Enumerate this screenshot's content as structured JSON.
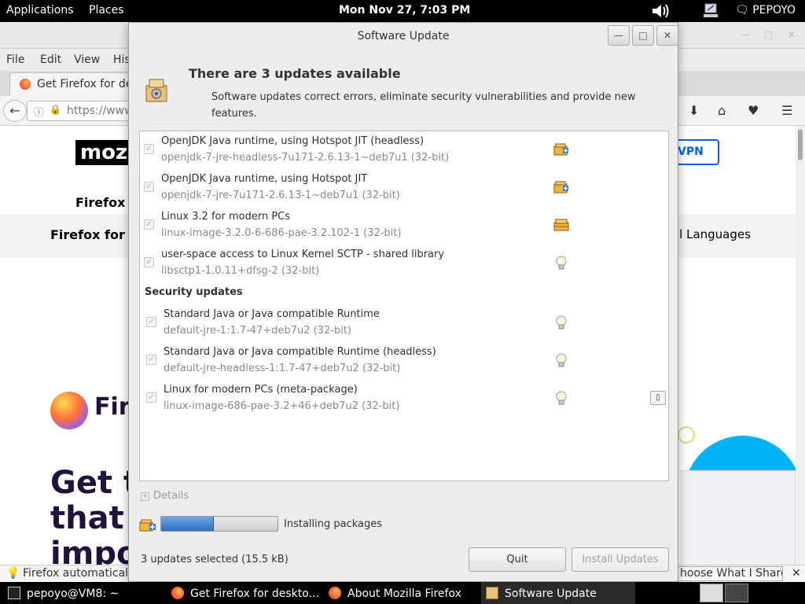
{
  "top_panel": {
    "applications": "Applications",
    "places": "Places",
    "clock": "Mon Nov 27,  7:03 PM",
    "user": "PEPOYO"
  },
  "firefox": {
    "menu": [
      "File",
      "Edit",
      "View",
      "His"
    ],
    "tab_title": "Get Firefox for de",
    "url": "https://www",
    "page": {
      "logo": "moz",
      "vpn": "VPN",
      "subnav": "Firefox B",
      "band_left": "Firefox for D",
      "band_right": "ll Languages",
      "brand": "Fire",
      "headline": [
        "Get t",
        "that p",
        "impo"
      ]
    },
    "status_left": "Firefox automatically",
    "status_right": "hoose What I Share"
  },
  "dialog": {
    "title": "Software Update",
    "heading": "There are 3 updates available",
    "subheading": "Software updates correct errors, eliminate security vulnerabilities and provide new features.",
    "updates": [
      {
        "name": "OpenJDK Java runtime, using Hotspot JIT (headless)",
        "package": "openjdk-7-jre-headless-7u171-2.6.13-1~deb7u1 (32-bit)",
        "icon": "package-add-icon"
      },
      {
        "name": "OpenJDK Java runtime, using Hotspot JIT",
        "package": "openjdk-7-jre-7u171-2.6.13-1~deb7u1 (32-bit)",
        "icon": "package-add-icon"
      },
      {
        "name": "Linux 3.2 for modern PCs",
        "package": "linux-image-3.2.0-6-686-pae-3.2.102-1 (32-bit)",
        "icon": "package-icon"
      },
      {
        "name": "user-space access to Linux Kernel SCTP - shared library",
        "package": "libsctp1-1.0.11+dfsg-2 (32-bit)",
        "icon": "lightbulb-icon"
      }
    ],
    "security_heading": "Security updates",
    "security_updates": [
      {
        "name": "Standard Java or Java compatible Runtime",
        "package": "default-jre-1:1.7-47+deb7u2 (32-bit)",
        "icon": "lightbulb-icon"
      },
      {
        "name": "Standard Java or Java compatible Runtime (headless)",
        "package": "default-jre-headless-1:1.7-47+deb7u2 (32-bit)",
        "icon": "lightbulb-icon"
      },
      {
        "name": "Linux for modern PCs (meta-package)",
        "package": "linux-image-686-pae-3.2+46+deb7u2 (32-bit)",
        "icon": "lightbulb-icon"
      }
    ],
    "details_label": "Details",
    "progress": {
      "fraction": 0.45,
      "label": "Installing packages"
    },
    "selected_summary": "3 updates selected (15.5 kB)",
    "quit_label": "Quit",
    "install_label": "Install Updates"
  },
  "taskbar": {
    "items": [
      "pepoyo@VM8: ~",
      "Get Firefox for deskto...",
      "About Mozilla Firefox",
      "Software Update"
    ]
  }
}
